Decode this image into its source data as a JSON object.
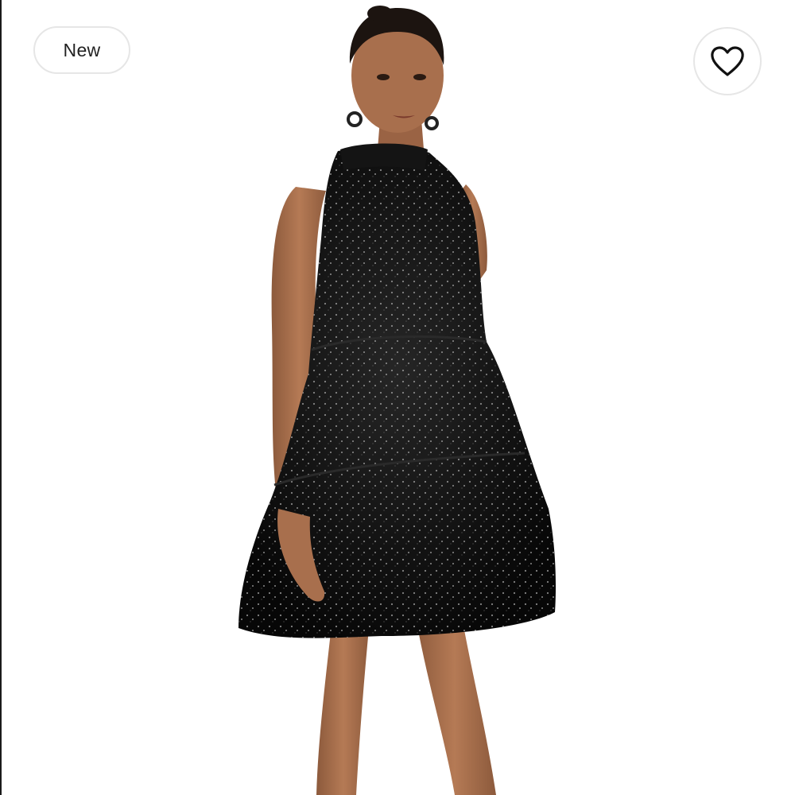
{
  "listing": {
    "badge_label": "New",
    "like_icon": "heart-outline-icon",
    "image_subject": "product-photo"
  },
  "colors": {
    "badge_border": "#e6e6e6",
    "badge_text": "#222222",
    "background": "#ffffff",
    "dress": "#0d0d0d",
    "skin": "#a86f4d"
  }
}
